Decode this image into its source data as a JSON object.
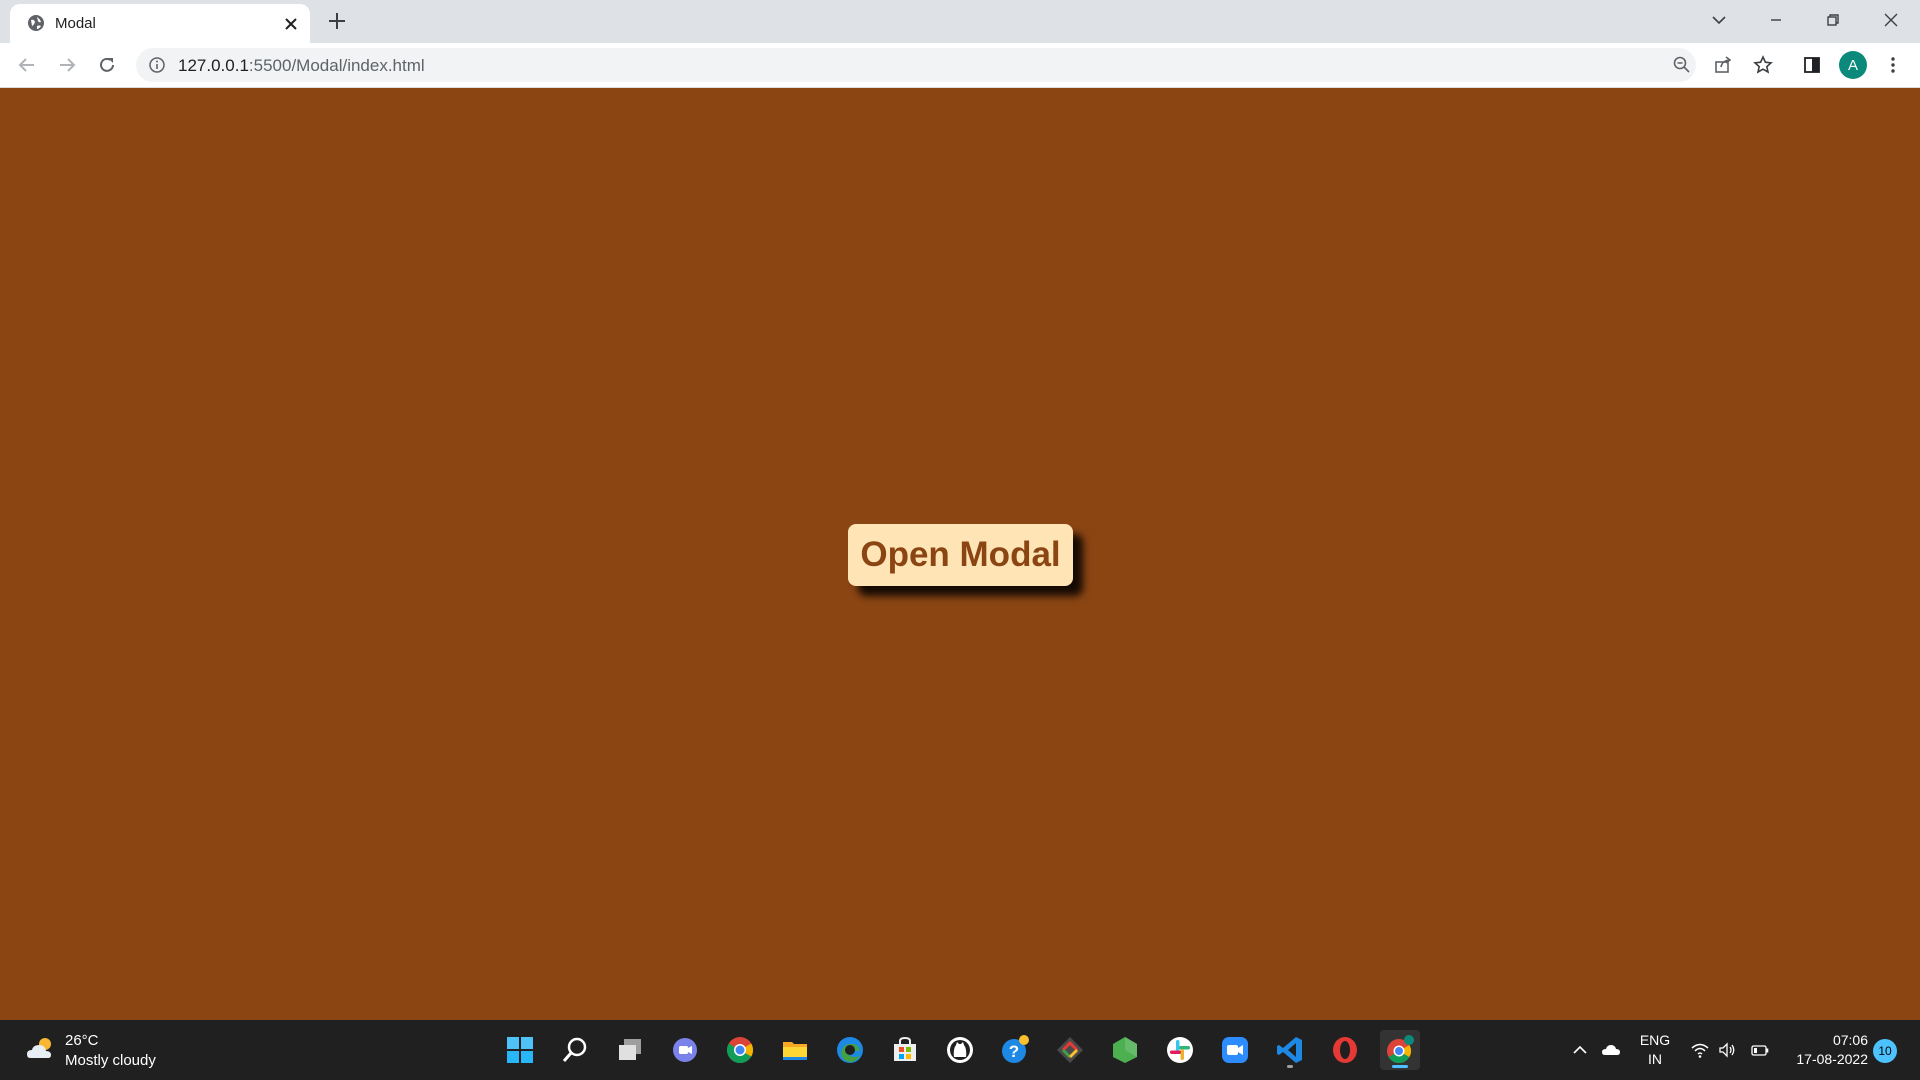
{
  "browser": {
    "tab_title": "Modal",
    "url_host": "127.0.0.1",
    "url_path": ":5500/Modal/index.html",
    "profile_initial": "A"
  },
  "page": {
    "background_color": "#8b4513",
    "button_label": "Open Modal",
    "button_bg": "#ffe4b5",
    "button_text_color": "#8b4513"
  },
  "taskbar": {
    "weather_temp": "26°C",
    "weather_desc": "Mostly cloudy",
    "apps": [
      "start",
      "search",
      "task-view",
      "teams-chat",
      "chrome",
      "file-explorer",
      "edge",
      "microsoft-store",
      "github",
      "get-help",
      "git-gui",
      "node-js",
      "slack",
      "zoom",
      "vs-code",
      "opera",
      "chrome-profile"
    ],
    "lang_line1": "ENG",
    "lang_line2": "IN",
    "time": "07:06",
    "date": "17-08-2022",
    "notification_count": "10"
  }
}
